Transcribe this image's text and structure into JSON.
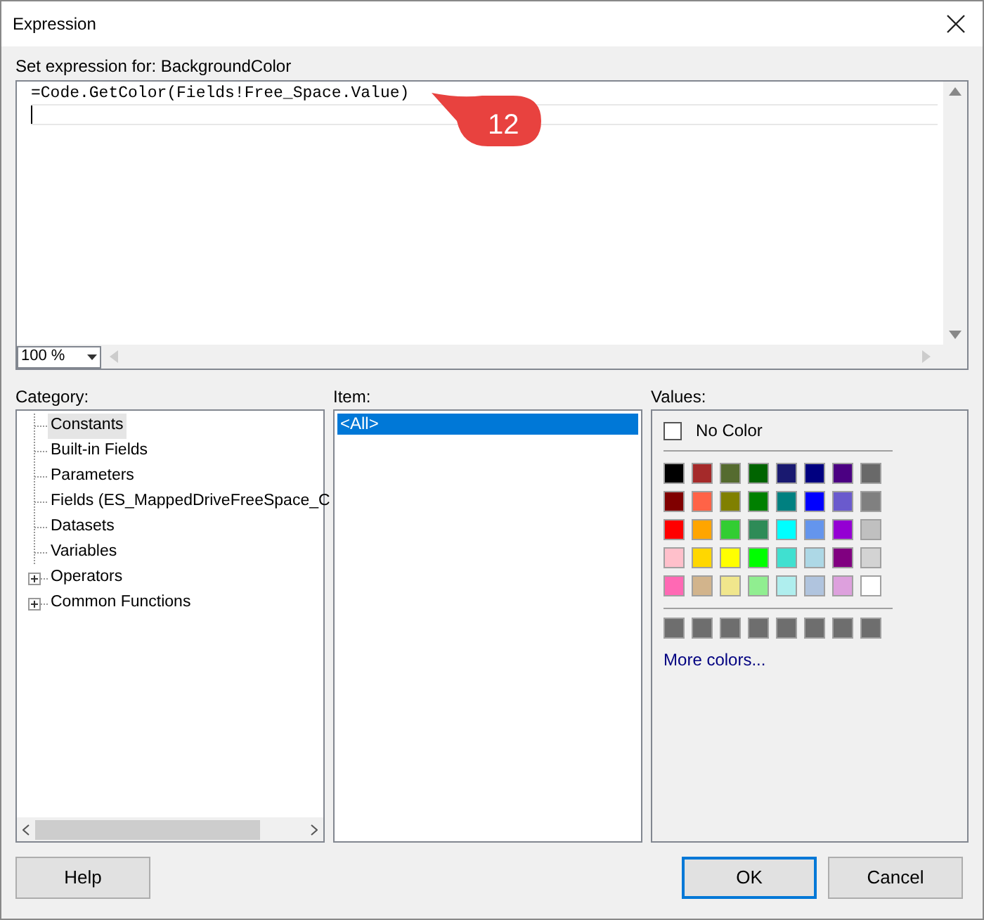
{
  "window": {
    "title": "Expression"
  },
  "expression": {
    "label": "Set expression for: BackgroundColor",
    "value": "=Code.GetColor(Fields!Free_Space.Value)",
    "zoom": "100 %"
  },
  "callout": {
    "text": "12"
  },
  "category": {
    "label": "Category:",
    "items": [
      {
        "label": "Constants",
        "selected": true,
        "expandable": false
      },
      {
        "label": "Built-in Fields",
        "selected": false,
        "expandable": false
      },
      {
        "label": "Parameters",
        "selected": false,
        "expandable": false
      },
      {
        "label": "Fields (ES_MappedDriveFreeSpace_C",
        "selected": false,
        "expandable": false
      },
      {
        "label": "Datasets",
        "selected": false,
        "expandable": false
      },
      {
        "label": "Variables",
        "selected": false,
        "expandable": false
      },
      {
        "label": "Operators",
        "selected": false,
        "expandable": true
      },
      {
        "label": "Common Functions",
        "selected": false,
        "expandable": true
      }
    ]
  },
  "item": {
    "label": "Item:",
    "items": [
      {
        "label": "<All>",
        "selected": true
      }
    ]
  },
  "values": {
    "label": "Values:",
    "no_color": {
      "label": "No Color",
      "checked": false
    },
    "swatches": [
      [
        {
          "color": "#000000"
        },
        {
          "color": "#a52a2a"
        },
        {
          "color": "#556b2f"
        },
        {
          "color": "#006400"
        },
        {
          "color": "#191970"
        },
        {
          "color": "#000080"
        },
        {
          "color": "#4b0082"
        },
        {
          "color": "#696969"
        }
      ],
      [
        {
          "color": "#800000"
        },
        {
          "color": "#ff6347"
        },
        {
          "color": "#808000"
        },
        {
          "color": "#008000"
        },
        {
          "color": "#008080"
        },
        {
          "color": "#0000ff"
        },
        {
          "color": "#6a5acd"
        },
        {
          "color": "#808080"
        }
      ],
      [
        {
          "color": "#ff0000"
        },
        {
          "color": "#ffa500"
        },
        {
          "color": "#32cd32"
        },
        {
          "color": "#2e8b57"
        },
        {
          "color": "#00ffff"
        },
        {
          "color": "#6495ed"
        },
        {
          "color": "#9400d3"
        },
        {
          "color": "#c0c0c0"
        }
      ],
      [
        {
          "color": "#ffc0cb"
        },
        {
          "color": "#ffd700"
        },
        {
          "color": "#ffff00"
        },
        {
          "color": "#00ff00"
        },
        {
          "color": "#40e0d0"
        },
        {
          "color": "#add8e6"
        },
        {
          "color": "#800080"
        },
        {
          "color": "#d3d3d3"
        }
      ],
      [
        {
          "color": "#ff69b4"
        },
        {
          "color": "#d2b48c"
        },
        {
          "color": "#f0e68c"
        },
        {
          "color": "#90ee90"
        },
        {
          "color": "#afeeee"
        },
        {
          "color": "#b0c4de"
        },
        {
          "color": "#dda0dd"
        },
        {
          "color": "#ffffff"
        }
      ]
    ],
    "recent": [
      {
        "color": "#6e6e6e"
      },
      {
        "color": "#6e6e6e"
      },
      {
        "color": "#6e6e6e"
      },
      {
        "color": "#6e6e6e"
      },
      {
        "color": "#6e6e6e"
      },
      {
        "color": "#6e6e6e"
      },
      {
        "color": "#6e6e6e"
      },
      {
        "color": "#6e6e6e"
      }
    ],
    "more_link": "More colors..."
  },
  "buttons": [
    {
      "label": "Help",
      "default": false
    },
    {
      "label": "OK",
      "default": true
    },
    {
      "label": "Cancel",
      "default": false
    }
  ]
}
